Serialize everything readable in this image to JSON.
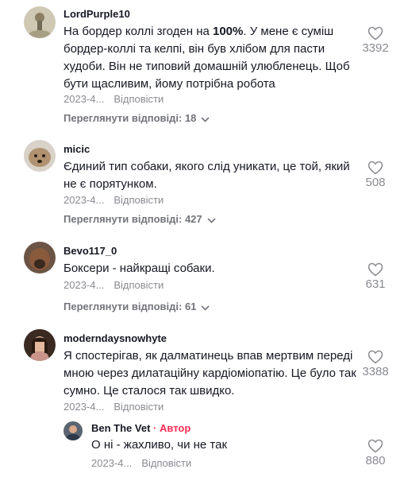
{
  "comments": [
    {
      "username": "LordPurple10",
      "text_before_bold": "На бордер коллі згоден на ",
      "text_bold": "100%",
      "text_after_bold": ". У мене є суміш бордер-коллі та келпі, він був хлібом для пасти худоби. Він не типовий домашній улюбленець. Щоб бути щасливим, йому потрібна робота",
      "date": "2023-4...",
      "reply_label": "Відповісти",
      "view_replies": "Переглянути відповіді: 18",
      "likes": "3392"
    },
    {
      "username": "micic",
      "text": "Єдиний тип собаки, якого слід уникати, це той, який не є порятунком.",
      "date": "2023-4...",
      "reply_label": "Відповісти",
      "view_replies": "Переглянути відповіді: 427",
      "likes": "508"
    },
    {
      "username": "Bevo117_0",
      "text": "Боксери - найкращі собаки.",
      "date": "2023-4...",
      "reply_label": "Відповісти",
      "view_replies": "Переглянути відповіді: 61",
      "likes": "631"
    },
    {
      "username": "moderndaysnowhyte",
      "text": "Я спостерігав, як далматинець впав мертвим переді мною через дилатаційну кардіоміопатію. Це було так сумно. Це сталося так швидко.",
      "date": "2023-4...",
      "reply_label": "Відповісти",
      "likes": "3388"
    }
  ],
  "reply": {
    "username": "Ben The Vet",
    "separator": "·",
    "author_label": "Автор",
    "text": "О ні - жахливо, чи не так",
    "date": "2023-4...",
    "reply_label": "Відповісти",
    "likes": "880"
  },
  "icons": {
    "like": "heart-outline-icon",
    "expand": "chevron-down-icon"
  },
  "colors": {
    "author": "#fe2c55",
    "muted": "#8a8b91",
    "text": "#161823"
  }
}
